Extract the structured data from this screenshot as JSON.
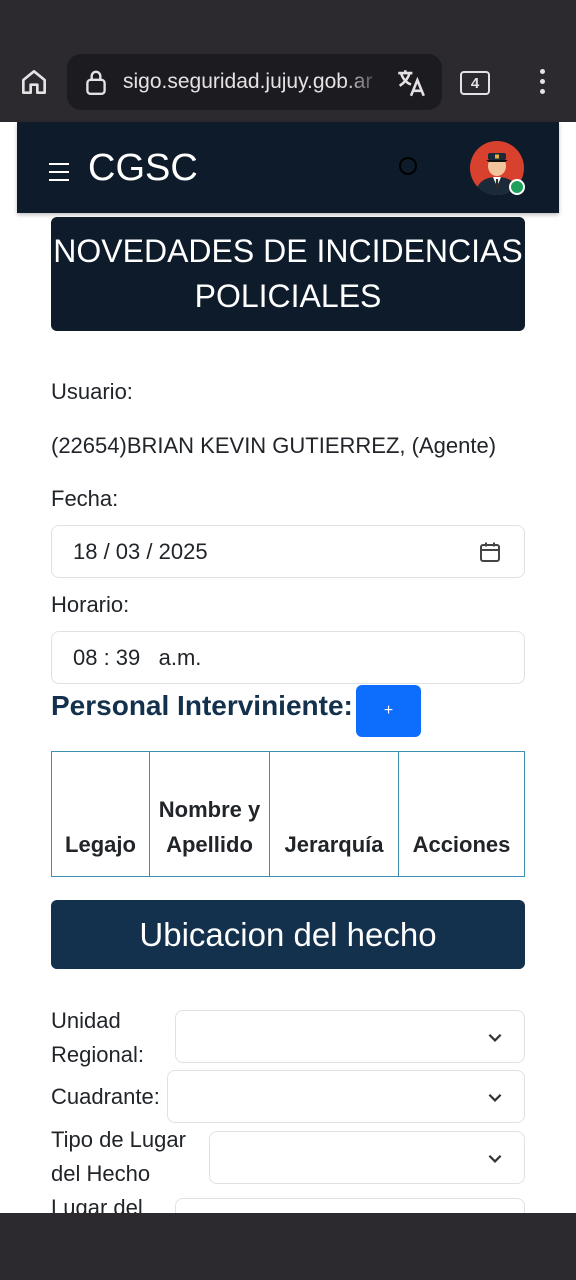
{
  "browser": {
    "url": "sigo.seguridad.jujuy.gob.ar",
    "tab_count": "4",
    "icons": [
      "home-icon",
      "lock-icon",
      "translate-icon",
      "tabs-icon",
      "more-vert-icon"
    ]
  },
  "navbar": {
    "brand": "CGSC",
    "icons": [
      "hamburger-icon",
      "theme-toggle-icon",
      "avatar"
    ]
  },
  "page": {
    "title": "NOVEDADES DE INCIDENCIAS POLICIALES",
    "user_label": "Usuario:",
    "user_value": "(22654)BRIAN KEVIN GUTIERREZ, (Agente)",
    "date_label": "Fecha:",
    "date_value": "18 / 03 / 2025",
    "time_label": "Horario:",
    "time_value": "08 : 39   a.m.",
    "personal_heading": "Personal Interviniente:",
    "add_button": "+",
    "table_headers": [
      "Legajo",
      "Nombre y Apellido",
      "Jerarquía",
      "Acciones"
    ],
    "location_heading": "Ubicacion del hecho",
    "fields": {
      "unidad_regional": "Unidad Regional:",
      "cuadrante": "Cuadrante:",
      "tipo_lugar": "Tipo de Lugar del Hecho",
      "lugar": "Lugar del"
    }
  },
  "colors": {
    "navbar_bg": "#0d1b2a",
    "section_bg": "#13304d",
    "primary_button": "#0d6efd",
    "table_border": "#3f8fb3",
    "online_status": "#1ea05c"
  }
}
